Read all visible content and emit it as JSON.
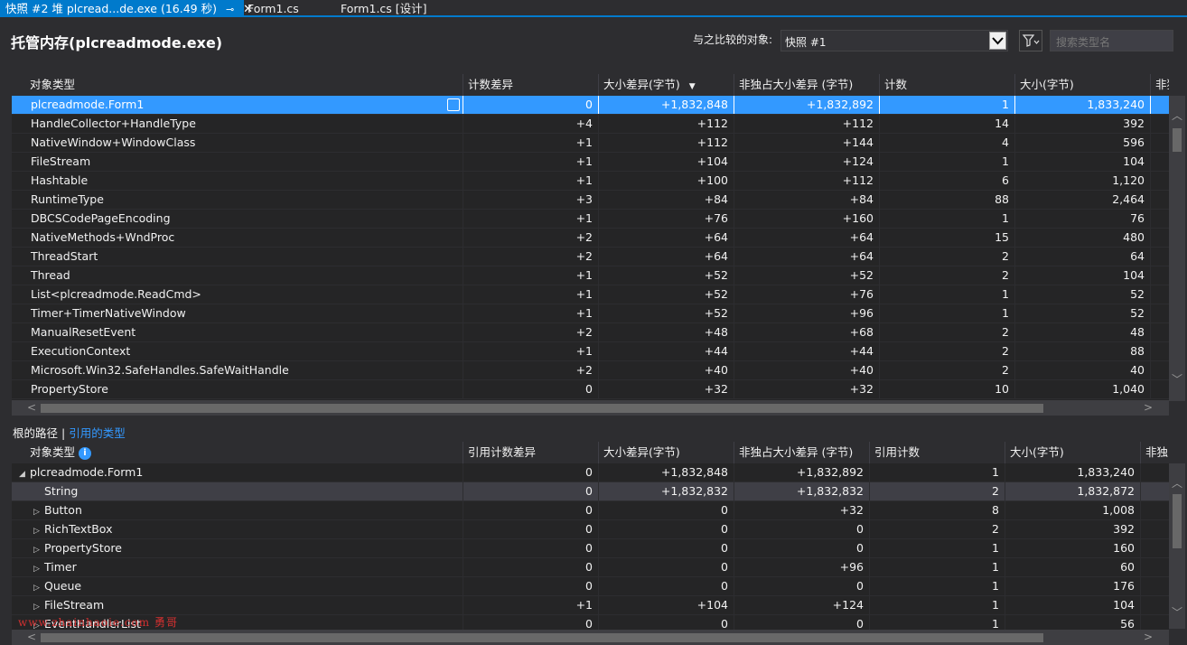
{
  "tabs": [
    {
      "label": "快照 #2 堆 plcread...de.exe (16.49 秒)",
      "pin": "⊸",
      "close": "✕",
      "active": true
    },
    {
      "label": "Form1.cs",
      "active": false
    },
    {
      "label": "Form1.cs [设计]",
      "active": false
    }
  ],
  "header": {
    "title": "托管内存(plcreadmode.exe)",
    "compare_label": "与之比较的对象:",
    "compare_value": "快照 #1",
    "search_placeholder": "搜索类型名"
  },
  "top_grid": {
    "columns": [
      "对象类型",
      "计数差异",
      "大小差异(字节)",
      "非独占大小差异 (字节)",
      "计数",
      "大小(字节)",
      "非独占"
    ],
    "sort_indicator": "▼",
    "rows": [
      [
        "plcreadmode.Form1",
        "0",
        "+1,832,848",
        "+1,832,892",
        "1",
        "1,833,240"
      ],
      [
        "HandleCollector+HandleType",
        "+4",
        "+112",
        "+112",
        "14",
        "392"
      ],
      [
        "NativeWindow+WindowClass",
        "+1",
        "+112",
        "+144",
        "4",
        "596"
      ],
      [
        "FileStream",
        "+1",
        "+104",
        "+124",
        "1",
        "104"
      ],
      [
        "Hashtable",
        "+1",
        "+100",
        "+112",
        "6",
        "1,120"
      ],
      [
        "RuntimeType",
        "+3",
        "+84",
        "+84",
        "88",
        "2,464"
      ],
      [
        "DBCSCodePageEncoding",
        "+1",
        "+76",
        "+160",
        "1",
        "76"
      ],
      [
        "NativeMethods+WndProc",
        "+2",
        "+64",
        "+64",
        "15",
        "480"
      ],
      [
        "ThreadStart",
        "+2",
        "+64",
        "+64",
        "2",
        "64"
      ],
      [
        "Thread",
        "+1",
        "+52",
        "+52",
        "2",
        "104"
      ],
      [
        "List<plcreadmode.ReadCmd>",
        "+1",
        "+52",
        "+76",
        "1",
        "52"
      ],
      [
        "Timer+TimerNativeWindow",
        "+1",
        "+52",
        "+96",
        "1",
        "52"
      ],
      [
        "ManualResetEvent",
        "+2",
        "+48",
        "+68",
        "2",
        "48"
      ],
      [
        "ExecutionContext",
        "+1",
        "+44",
        "+44",
        "2",
        "88"
      ],
      [
        "Microsoft.Win32.SafeHandles.SafeWaitHandle",
        "+2",
        "+40",
        "+40",
        "2",
        "40"
      ],
      [
        "PropertyStore",
        "0",
        "+32",
        "+32",
        "10",
        "1,040"
      ]
    ]
  },
  "subtabs": {
    "roots": "根的路径",
    "separator": "|",
    "refs": "引用的类型"
  },
  "bottom_grid": {
    "columns": [
      "对象类型",
      "引用计数差异",
      "大小差异(字节)",
      "非独占大小差异 (字节)",
      "引用计数",
      "大小(字节)",
      "非独占大"
    ],
    "info_icon": "i",
    "rows": [
      {
        "toggle": "◢",
        "indent": 0,
        "cells": [
          "plcreadmode.Form1",
          "0",
          "+1,832,848",
          "+1,832,892",
          "1",
          "1,833,240"
        ]
      },
      {
        "toggle": "",
        "indent": 1,
        "cells": [
          "String",
          "0",
          "+1,832,832",
          "+1,832,832",
          "2",
          "1,832,872"
        ]
      },
      {
        "toggle": "▷",
        "indent": 1,
        "cells": [
          "Button",
          "0",
          "0",
          "+32",
          "8",
          "1,008"
        ]
      },
      {
        "toggle": "▷",
        "indent": 1,
        "cells": [
          "RichTextBox",
          "0",
          "0",
          "0",
          "2",
          "392"
        ]
      },
      {
        "toggle": "▷",
        "indent": 1,
        "cells": [
          "PropertyStore",
          "0",
          "0",
          "0",
          "1",
          "160"
        ]
      },
      {
        "toggle": "▷",
        "indent": 1,
        "cells": [
          "Timer",
          "0",
          "0",
          "+96",
          "1",
          "60"
        ]
      },
      {
        "toggle": "▷",
        "indent": 1,
        "cells": [
          "Queue",
          "0",
          "0",
          "0",
          "1",
          "176"
        ]
      },
      {
        "toggle": "▷",
        "indent": 1,
        "cells": [
          "FileStream",
          "+1",
          "+104",
          "+124",
          "1",
          "104"
        ]
      },
      {
        "toggle": "▷",
        "indent": 1,
        "cells": [
          "EventHandlerList",
          "0",
          "0",
          "0",
          "1",
          "56"
        ]
      }
    ]
  },
  "watermark": "www.zhainhaoie.com 勇哥",
  "colors": {
    "accent": "#007acc",
    "selection": "#3399ff",
    "background": "#2d2d30",
    "grid": "#252526"
  }
}
